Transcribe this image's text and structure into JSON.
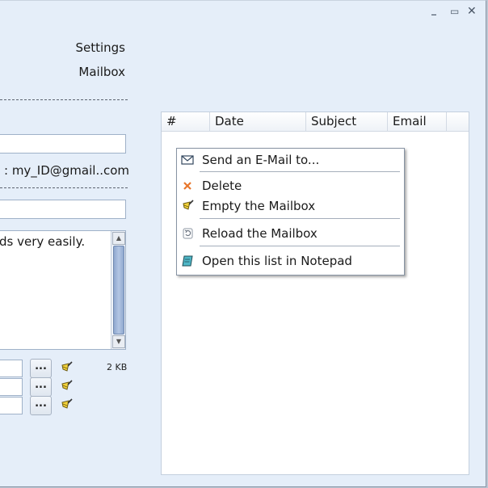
{
  "links": {
    "settings": "Settings",
    "mailbox": "Mailbox"
  },
  "account": {
    "text": ": my_ID@gmail..com"
  },
  "message": {
    "text": "ds very easily."
  },
  "attachments": {
    "button_label": "...",
    "size": "2 KB"
  },
  "list": {
    "columns": [
      "#",
      "Date",
      "Subject",
      "Email"
    ]
  },
  "context_menu": {
    "items": [
      {
        "label": "Send an E-Mail to...",
        "icon": "envelope-icon"
      },
      {
        "label": "Delete",
        "icon": "delete-x-icon"
      },
      {
        "label": "Empty the Mailbox",
        "icon": "broom-icon"
      },
      {
        "label": "Reload the Mailbox",
        "icon": "reload-icon"
      },
      {
        "label": "Open this list in Notepad",
        "icon": "notepad-icon"
      }
    ]
  },
  "colors": {
    "window_bg": "#e5eef9",
    "delete_icon": "#e8762b",
    "scroll_thumb": "#8fa8cf"
  }
}
